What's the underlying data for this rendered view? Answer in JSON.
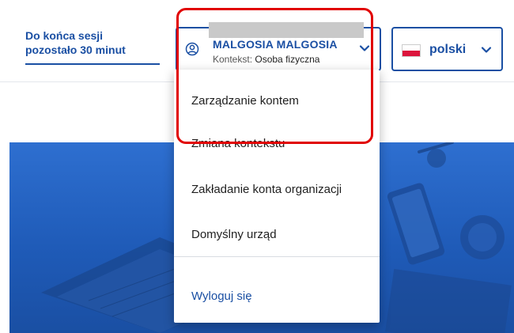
{
  "header": {
    "session_line1": "Do końca sesji",
    "session_line2": "pozostało 30 minut"
  },
  "user": {
    "name": "MALGOSIA MALGOSIA",
    "context_label": "Kontekst:",
    "context_value": "Osoba fizyczna",
    "icon": "user-circle-icon"
  },
  "language": {
    "label": "polski",
    "flag": "poland-flag-icon"
  },
  "menu": {
    "items": [
      {
        "label": "Zarządzanie kontem"
      },
      {
        "label": "Zmiana kontekstu"
      },
      {
        "label": "Zakładanie konta organizacji"
      },
      {
        "label": "Domyślny urząd"
      }
    ],
    "logout": "Wyloguj się"
  },
  "colors": {
    "brand_blue": "#1a4fa3",
    "highlight_red": "#e10000",
    "redaction_gray": "#c9c9c9"
  }
}
